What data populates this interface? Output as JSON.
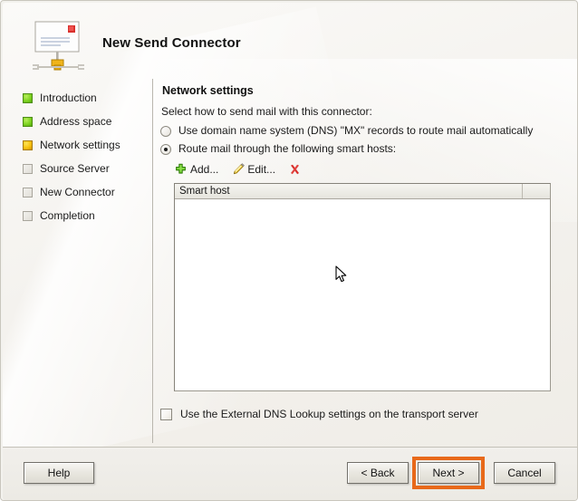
{
  "window": {
    "title": "New Send Connector",
    "icon": "send-connector-icon"
  },
  "sidebar": {
    "steps": [
      {
        "label": "Introduction",
        "state": "done"
      },
      {
        "label": "Address space",
        "state": "done"
      },
      {
        "label": "Network settings",
        "state": "current"
      },
      {
        "label": "Source Server",
        "state": "pending"
      },
      {
        "label": "New Connector",
        "state": "pending"
      },
      {
        "label": "Completion",
        "state": "pending"
      }
    ]
  },
  "content": {
    "section_title": "Network settings",
    "intro_text": "Select how to send mail with this connector:",
    "radios": [
      {
        "label": "Use domain name system (DNS) \"MX\" records to route mail automatically",
        "checked": false
      },
      {
        "label": "Route mail through the following smart hosts:",
        "checked": true
      }
    ],
    "toolbar": {
      "add_label": "Add...",
      "edit_label": "Edit...",
      "delete_label": "",
      "add_icon": "plus-icon",
      "edit_icon": "pencil-icon",
      "delete_icon": "red-x-icon"
    },
    "list": {
      "columns": [
        "Smart host",
        ""
      ],
      "rows": []
    },
    "external_dns_checkbox": {
      "label": "Use the External DNS Lookup settings on the transport server",
      "checked": false
    }
  },
  "footer": {
    "help_label": "Help",
    "back_label": "< Back",
    "next_label": "Next >",
    "cancel_label": "Cancel"
  },
  "annotation": {
    "highlight_color": "#e8691a",
    "highlight_target": "next-button"
  }
}
